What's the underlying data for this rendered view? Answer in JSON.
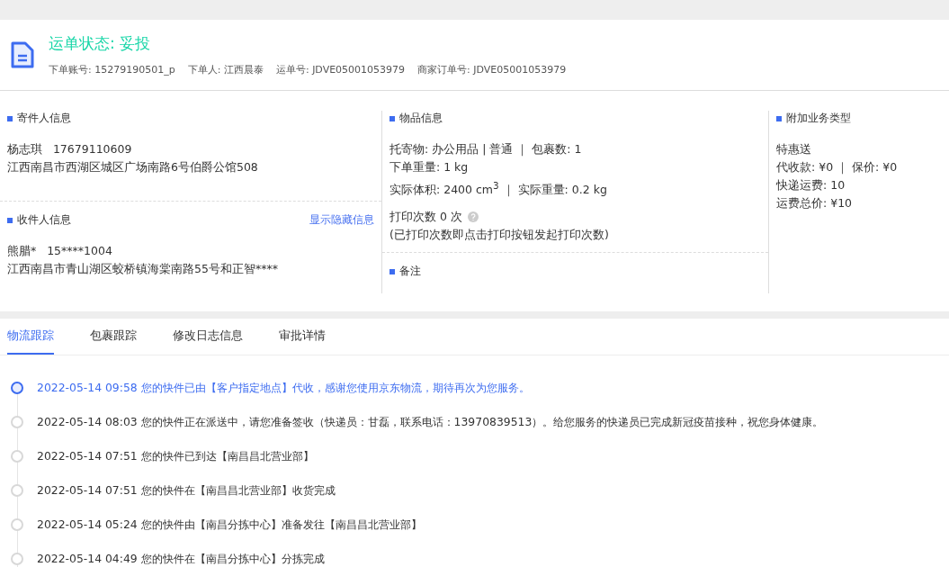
{
  "header": {
    "status": "运单状态: 妥投",
    "fields": [
      {
        "label": "下单账号:",
        "value": "15279190501_p"
      },
      {
        "label": "下单人:",
        "value": "江西晨泰"
      },
      {
        "label": "运单号:",
        "value": "JDVE05001053979"
      },
      {
        "label": "商家订单号:",
        "value": "JDVE05001053979"
      }
    ]
  },
  "sender": {
    "title": "寄件人信息",
    "name": "杨志琪",
    "phone": "17679110609",
    "address": "江西南昌市西湖区城区广场南路6号伯爵公馆508"
  },
  "receiver": {
    "title": "收件人信息",
    "link": "显示隐藏信息",
    "name": "熊腊*",
    "phone": "15****1004",
    "address": "江西南昌市青山湖区蛟桥镇海棠南路55号和正智****"
  },
  "goods": {
    "title": "物品信息",
    "lines": [
      "托寄物:  办公用品 | 普通 ｜ 包裹数:  1",
      "下单重量:  1 kg",
      "实际体积:   2400 cm$^{3}$ ｜ 实际重量:  0.2 kg"
    ],
    "print_label": "打印次数   0 次",
    "print_note": "(已打印次数即点击打印按钮发起打印次数)"
  },
  "remarks": {
    "title": "备注"
  },
  "extras": {
    "title": "附加业务类型",
    "lines": [
      "特惠送",
      "代收款:  ¥0 ｜ 保价:  ¥0",
      "快递运费:  10",
      "运费总价:  ¥10"
    ]
  },
  "tabs": [
    {
      "label": "物流跟踪",
      "selected": true
    },
    {
      "label": "包裹跟踪",
      "selected": false
    },
    {
      "label": "修改日志信息",
      "selected": false
    },
    {
      "label": "审批详情",
      "selected": false
    }
  ],
  "timeline": [
    {
      "text": "2022-05-14 09:58 您的快件已由【客户指定地点】代收，感谢您使用京东物流，期待再次为您服务。",
      "current": true
    },
    {
      "text": "2022-05-14 08:03 您的快件正在派送中，请您准备签收（快递员：甘磊，联系电话：13970839513）。给您服务的快递员已完成新冠疫苗接种，祝您身体健康。",
      "current": false
    },
    {
      "text": "2022-05-14 07:51 您的快件已到达【南昌昌北营业部】",
      "current": false
    },
    {
      "text": "2022-05-14 07:51 您的快件在【南昌昌北营业部】收货完成",
      "current": false
    },
    {
      "text": "2022-05-14 05:24 您的快件由【南昌分拣中心】准备发往【南昌昌北营业部】",
      "current": false
    },
    {
      "text": "2022-05-14 04:49 您的快件在【南昌分拣中心】分拣完成",
      "current": false
    }
  ]
}
